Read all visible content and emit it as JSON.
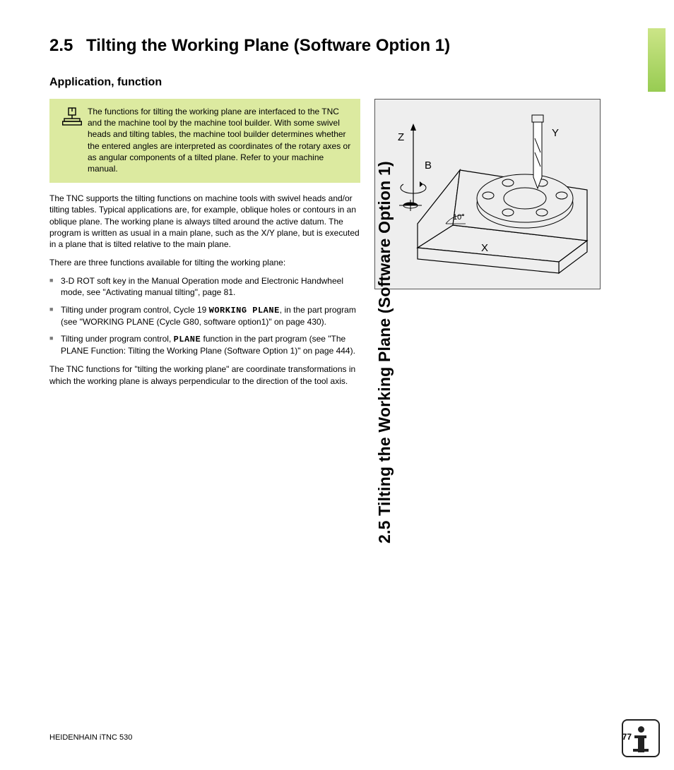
{
  "sideTab": "2.5 Tilting the Working Plane (Software Option 1)",
  "heading": {
    "num": "2.5",
    "title": "Tilting the Working Plane (Software Option 1)"
  },
  "subheading": "Application, function",
  "note": "The functions for tilting the working plane are interfaced to the TNC and the machine tool by the machine tool builder. With some swivel heads and tilting tables, the machine tool builder determines whether the entered angles are interpreted as coordinates of the rotary axes or as angular components of a tilted plane. Refer to your machine manual.",
  "para1": "The TNC supports the tilting functions on machine tools with swivel heads and/or tilting tables. Typical applications are, for example, oblique holes or contours in an oblique plane. The working plane is always tilted around the active datum. The program is written as usual in a main plane, such as the X/Y plane, but is executed in a plane that is tilted relative to the main plane.",
  "para2": "There are three functions available for tilting the working plane:",
  "bullets": [
    {
      "pre": "3-D ROT soft key in the Manual Operation mode and Electronic Handwheel mode, see \"Activating manual tilting\", page 81."
    },
    {
      "pre": "Tilting under program control, Cycle 19 ",
      "mono": "WORKING PLANE",
      "post": ", in the part program (see \"WORKING PLANE (Cycle G80, software option1)\" on page 430)."
    },
    {
      "pre": "Tilting under program control, ",
      "mono": "PLANE",
      "post": " function in the part program (see \"The PLANE Function: Tilting the Working Plane (Software Option 1)\" on page 444)."
    }
  ],
  "para3": "The TNC functions for \"tilting the working plane\" are coordinate transformations in which the working plane is always perpendicular to the direction of the tool axis.",
  "figure": {
    "Z": "Z",
    "B": "B",
    "X": "X",
    "Y": "Y",
    "angle": "10°"
  },
  "footer": {
    "left": "HEIDENHAIN iTNC 530",
    "page": "77"
  }
}
